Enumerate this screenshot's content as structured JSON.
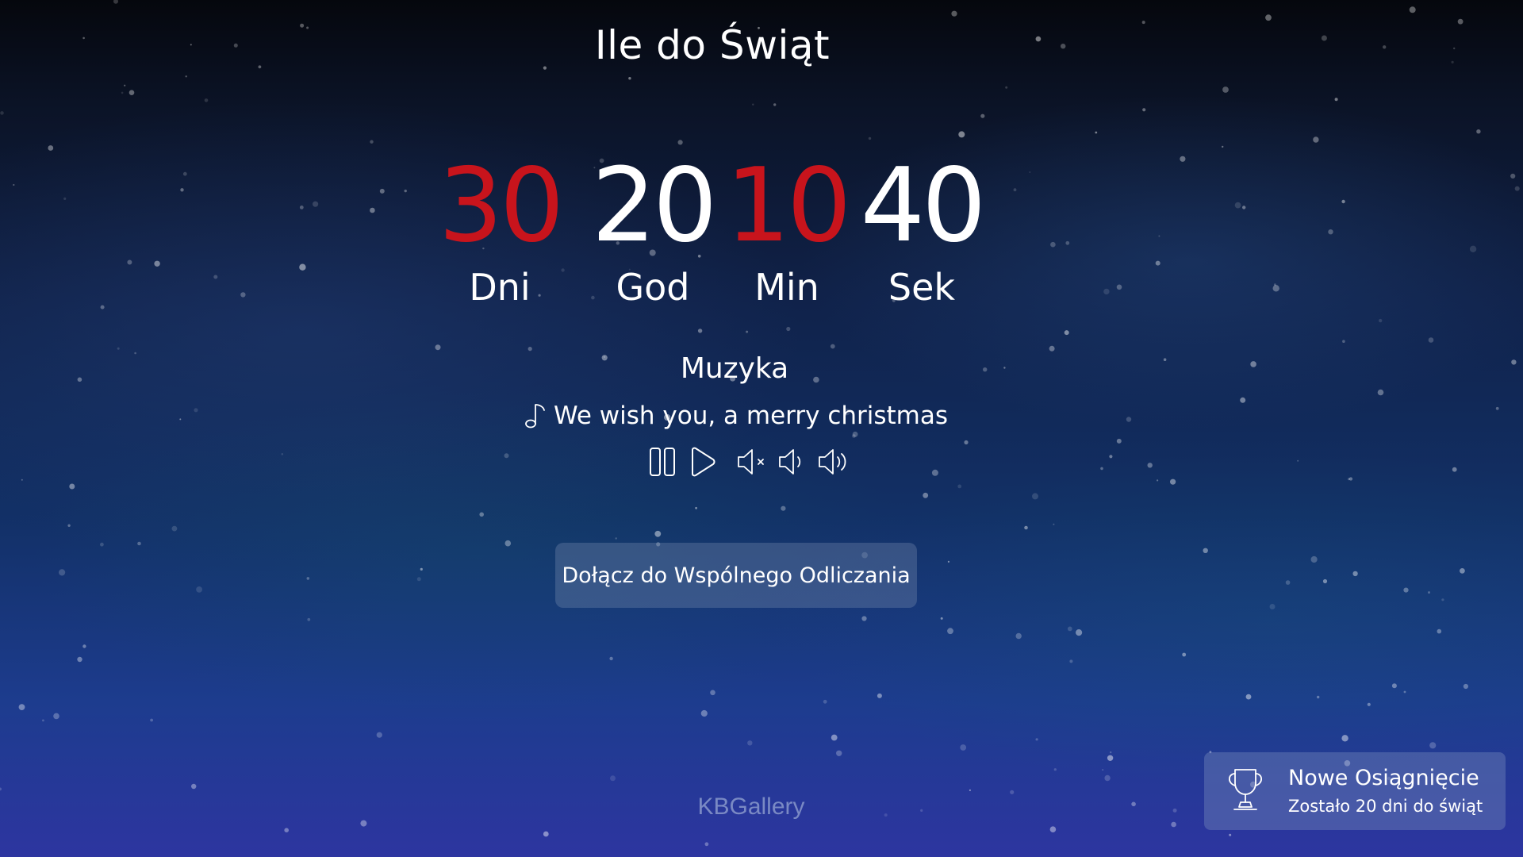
{
  "page": {
    "title": "Ile do Świąt"
  },
  "countdown": [
    {
      "value": "30",
      "label": "Dni",
      "color": "#c8141c"
    },
    {
      "value": "20",
      "label": "God",
      "color": "#ffffff"
    },
    {
      "value": "10",
      "label": "Min",
      "color": "#c8141c"
    },
    {
      "value": "40",
      "label": "Sek",
      "color": "#ffffff"
    }
  ],
  "music": {
    "heading": "Muzyka",
    "track_icon": "music-note-icon",
    "track": "We wish you, a merry christmas",
    "controls": [
      "pause-icon",
      "play-icon",
      "volume-mute-icon",
      "volume-low-icon",
      "volume-high-icon"
    ]
  },
  "join_button": {
    "label": "Dołącz do Wspólnego Odliczania"
  },
  "footer": {
    "brand": "KBGallery"
  },
  "achievement": {
    "icon": "trophy-icon",
    "title": "Nowe Osiągnięcie",
    "message": "Zostało 20 dni do świąt"
  }
}
